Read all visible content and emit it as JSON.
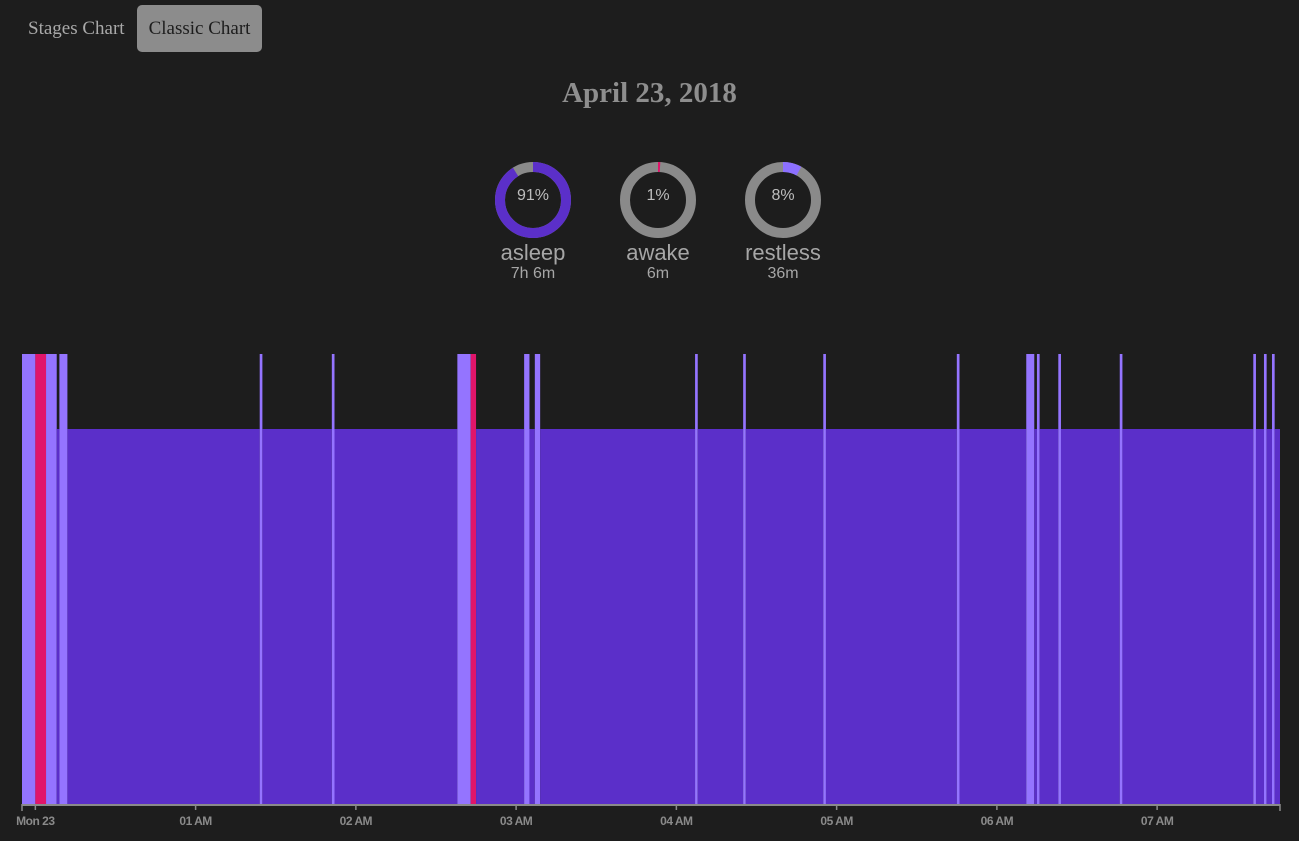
{
  "tabs": [
    {
      "label": "Stages Chart",
      "active": false
    },
    {
      "label": "Classic Chart",
      "active": true
    }
  ],
  "date": "April 23, 2018",
  "summary": [
    {
      "key": "asleep",
      "percent": "91%",
      "fraction": 0.91,
      "label": "asleep",
      "duration": "7h 6m",
      "color": "#5b2fc9"
    },
    {
      "key": "awake",
      "percent": "1%",
      "fraction": 0.01,
      "label": "awake",
      "duration": "6m",
      "color": "#e0156a"
    },
    {
      "key": "restless",
      "percent": "8%",
      "fraction": 0.08,
      "label": "restless",
      "duration": "36m",
      "color": "#8c70ff"
    }
  ],
  "colors": {
    "asleep": "#5b2fc9",
    "restless": "#9474ff",
    "awake": "#e0156a",
    "ring_track": "#8a8a8a",
    "background": "#1d1d1d"
  },
  "chart_data": {
    "type": "bar",
    "x_axis": {
      "start": "23:55",
      "end": "07:46",
      "tick_labels": [
        "Mon 23",
        "01 AM",
        "02 AM",
        "03 AM",
        "04 AM",
        "05 AM",
        "06 AM",
        "07 AM"
      ],
      "tick_times": [
        "00:00",
        "01:00",
        "02:00",
        "03:00",
        "04:00",
        "05:00",
        "06:00",
        "07:00"
      ]
    },
    "levels": [
      "asleep",
      "restless",
      "awake"
    ],
    "segments": [
      {
        "start": "23:55",
        "end": "00:00",
        "level": "restless"
      },
      {
        "start": "00:00",
        "end": "00:04",
        "level": "awake"
      },
      {
        "start": "00:04",
        "end": "00:08",
        "level": "restless"
      },
      {
        "start": "00:08",
        "end": "00:09",
        "level": "asleep"
      },
      {
        "start": "00:09",
        "end": "00:12",
        "level": "restless"
      },
      {
        "start": "00:12",
        "end": "01:24",
        "level": "asleep"
      },
      {
        "start": "01:24",
        "end": "01:25",
        "level": "restless"
      },
      {
        "start": "01:25",
        "end": "01:51",
        "level": "asleep"
      },
      {
        "start": "01:51",
        "end": "01:52",
        "level": "restless"
      },
      {
        "start": "01:52",
        "end": "02:38",
        "level": "asleep"
      },
      {
        "start": "02:38",
        "end": "02:43",
        "level": "restless"
      },
      {
        "start": "02:43",
        "end": "02:45",
        "level": "awake"
      },
      {
        "start": "02:45",
        "end": "03:03",
        "level": "asleep"
      },
      {
        "start": "03:03",
        "end": "03:05",
        "level": "restless"
      },
      {
        "start": "03:05",
        "end": "03:07",
        "level": "asleep"
      },
      {
        "start": "03:07",
        "end": "03:09",
        "level": "restless"
      },
      {
        "start": "03:09",
        "end": "04:07",
        "level": "asleep"
      },
      {
        "start": "04:07",
        "end": "04:08",
        "level": "restless"
      },
      {
        "start": "04:08",
        "end": "04:25",
        "level": "asleep"
      },
      {
        "start": "04:25",
        "end": "04:26",
        "level": "restless"
      },
      {
        "start": "04:26",
        "end": "04:55",
        "level": "asleep"
      },
      {
        "start": "04:55",
        "end": "04:56",
        "level": "restless"
      },
      {
        "start": "04:56",
        "end": "05:45",
        "level": "asleep"
      },
      {
        "start": "05:45",
        "end": "05:46",
        "level": "restless"
      },
      {
        "start": "05:46",
        "end": "06:11",
        "level": "asleep"
      },
      {
        "start": "06:11",
        "end": "06:14",
        "level": "restless"
      },
      {
        "start": "06:14",
        "end": "06:15",
        "level": "asleep"
      },
      {
        "start": "06:15",
        "end": "06:16",
        "level": "restless"
      },
      {
        "start": "06:16",
        "end": "06:23",
        "level": "asleep"
      },
      {
        "start": "06:23",
        "end": "06:24",
        "level": "restless"
      },
      {
        "start": "06:24",
        "end": "06:46",
        "level": "asleep"
      },
      {
        "start": "06:46",
        "end": "06:47",
        "level": "restless"
      },
      {
        "start": "06:47",
        "end": "07:36",
        "level": "asleep"
      },
      {
        "start": "07:36",
        "end": "07:37",
        "level": "restless"
      },
      {
        "start": "07:37",
        "end": "07:40",
        "level": "asleep"
      },
      {
        "start": "07:40",
        "end": "07:41",
        "level": "restless"
      },
      {
        "start": "07:41",
        "end": "07:43",
        "level": "asleep"
      },
      {
        "start": "07:43",
        "end": "07:44",
        "level": "restless"
      },
      {
        "start": "07:44",
        "end": "07:46",
        "level": "asleep"
      }
    ]
  }
}
